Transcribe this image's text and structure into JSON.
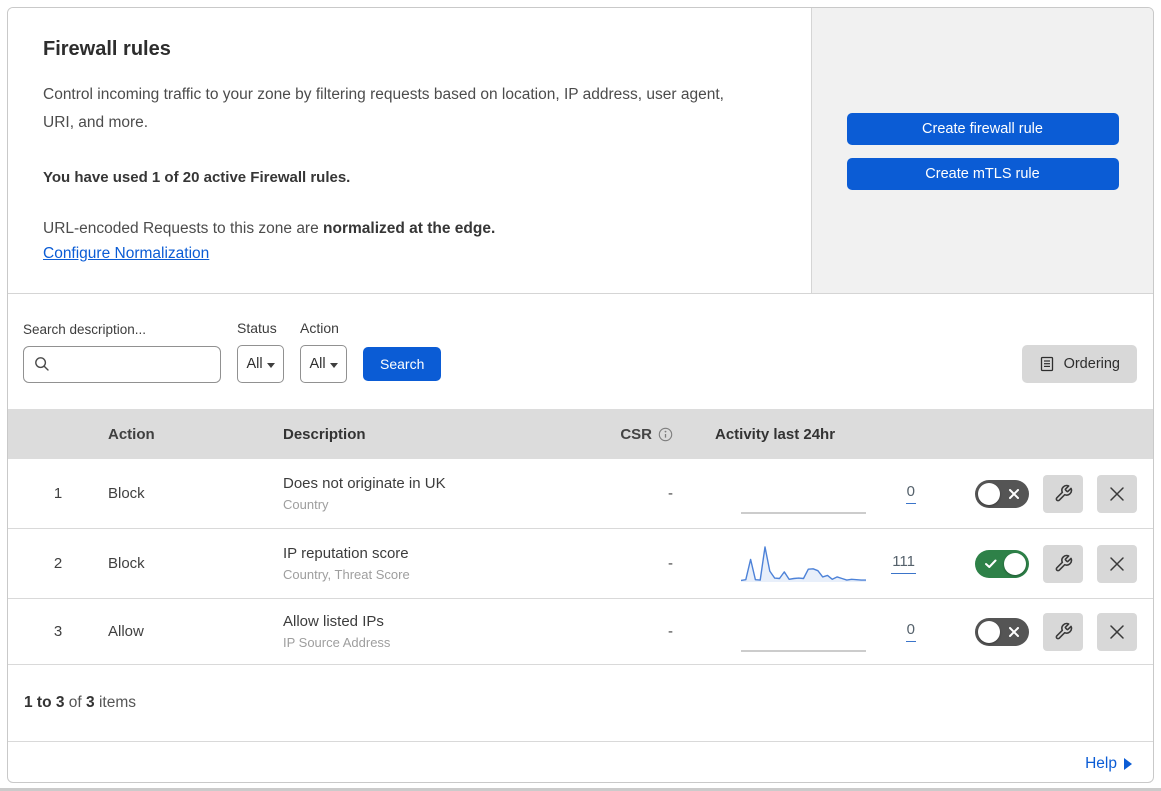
{
  "header": {
    "title": "Firewall rules",
    "description": "Control incoming traffic to your zone by filtering requests based on location, IP address, user agent, URI, and more.",
    "usage": "You have used 1 of 20 active Firewall rules.",
    "normalization_prefix": "URL-encoded Requests to this zone are ",
    "normalization_bold": "normalized at the edge.",
    "normalization_link": "Configure Normalization",
    "buttons": [
      {
        "label": "Create firewall rule"
      },
      {
        "label": "Create mTLS rule"
      }
    ]
  },
  "filters": {
    "search_label": "Search description...",
    "search_value": "",
    "status_label": "Status",
    "status_value": "All",
    "action_label": "Action",
    "action_value": "All",
    "search_button": "Search",
    "ordering_button": "Ordering"
  },
  "table": {
    "columns": {
      "action": "Action",
      "description": "Description",
      "csr": "CSR",
      "activity": "Activity last 24hr"
    },
    "rows": [
      {
        "num": "1",
        "action": "Block",
        "description": "Does not originate in UK",
        "fields": "Country",
        "csr": "-",
        "activity_count": "0",
        "enabled": false,
        "sparkline": [
          0,
          0,
          0,
          0,
          0,
          0,
          0,
          0,
          0,
          0,
          0,
          0
        ]
      },
      {
        "num": "2",
        "action": "Block",
        "description": "IP reputation score",
        "fields": "Country, Threat Score",
        "csr": "-",
        "activity_count": "111",
        "enabled": true,
        "sparkline": [
          4,
          6,
          58,
          6,
          5,
          90,
          28,
          10,
          9,
          26,
          7,
          9,
          10,
          9,
          33,
          34,
          29,
          13,
          17,
          7,
          13,
          9,
          5,
          7,
          6,
          5,
          5
        ]
      },
      {
        "num": "3",
        "action": "Allow",
        "description": "Allow listed IPs",
        "fields": "IP Source Address",
        "csr": "-",
        "activity_count": "0",
        "enabled": false,
        "sparkline": [
          0,
          0,
          0,
          0,
          0,
          0,
          0,
          0,
          0,
          0,
          0,
          0
        ]
      }
    ]
  },
  "footer": {
    "range_bold": "1 to 3",
    "of_text": " of ",
    "total_bold": "3",
    "items_text": " items",
    "help_label": "Help"
  },
  "colors": {
    "accent_blue": "#0b5cd5",
    "toggle_on_green": "#2e8148",
    "toggle_off_gray": "#555555",
    "panel_gray": "#f1f1f1",
    "table_header_gray": "#dcdcdc",
    "sparkline_blue": "#4d82d8"
  }
}
